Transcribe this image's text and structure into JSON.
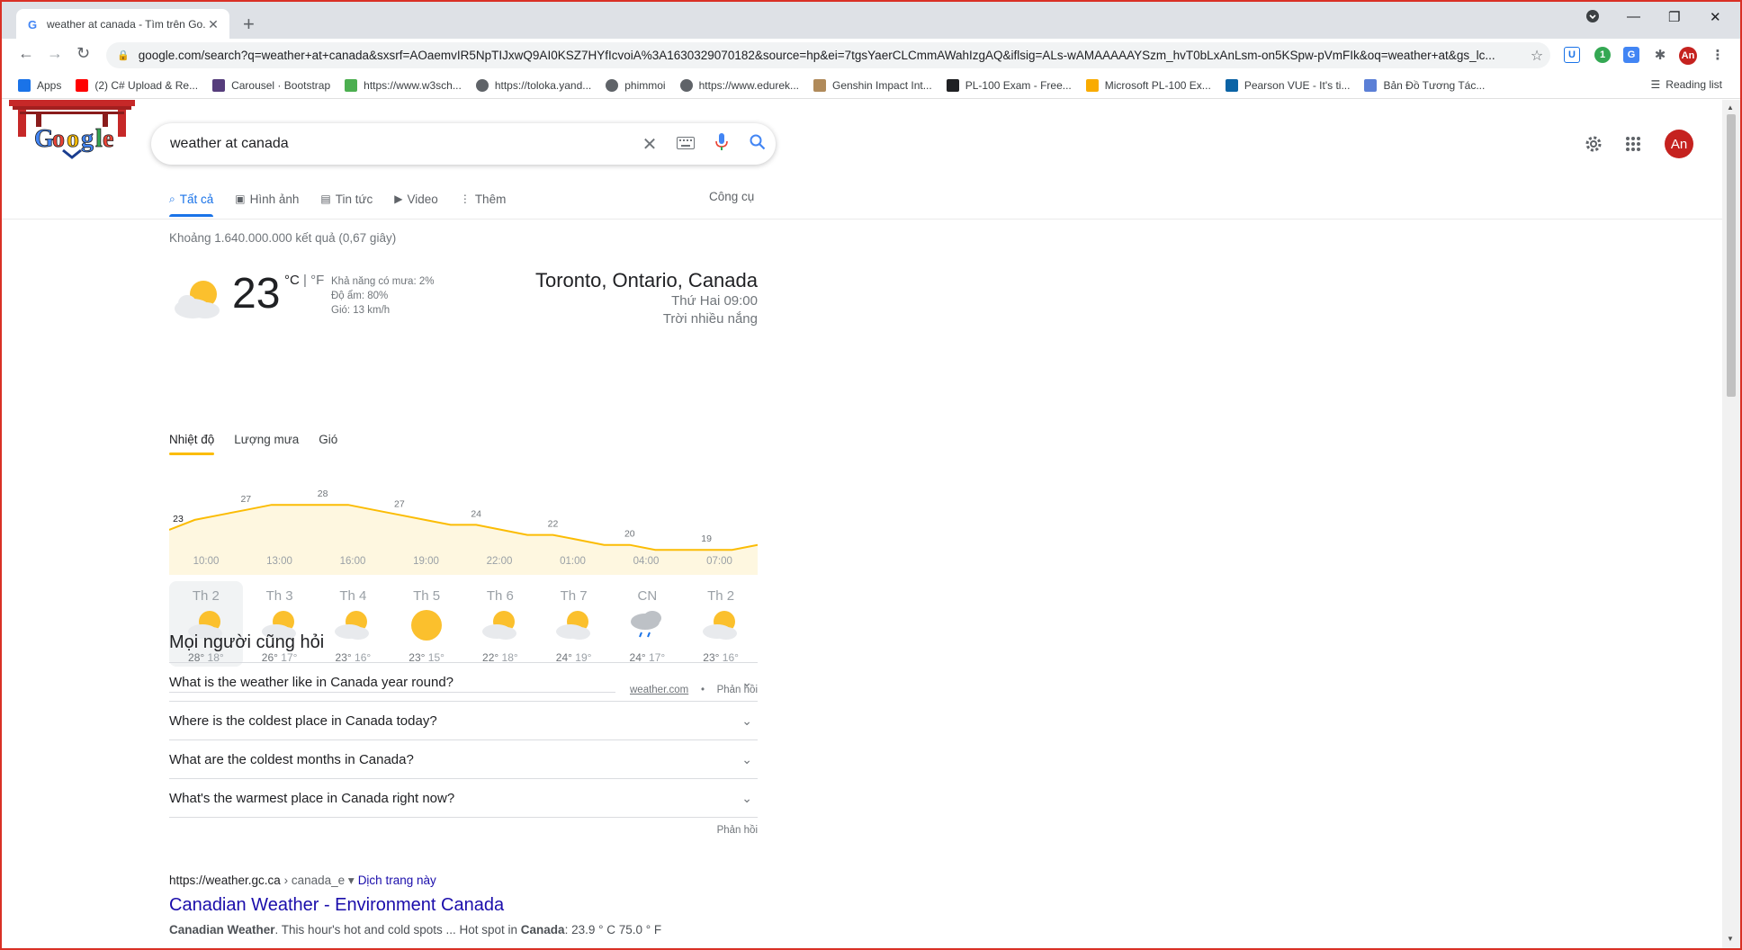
{
  "browser": {
    "tab_title": "weather at canada - Tìm trên Go...",
    "url": "google.com/search?q=weather+at+canada&sxsrf=AOaemvIR5NpTIJxwQ9AI0KSZ7HYfIcvoiA%3A1630329070182&source=hp&ei=7tgsYaerCLCmmAWahIzgAQ&iflsig=ALs-wAMAAAAAYSzm_hvT0bLxAnLsm-on5KSpw-pVmFIk&oq=weather+at&gs_lc...",
    "bookmarks": [
      {
        "label": "Apps",
        "icon": "apps-grid-icon",
        "color": "#1a73e8"
      },
      {
        "label": "(2) C# Upload & Re...",
        "icon": "youtube-icon",
        "color": "#ff0000"
      },
      {
        "label": "Carousel · Bootstrap",
        "icon": "bootstrap-icon",
        "color": "#563d7c"
      },
      {
        "label": "https://www.w3sch...",
        "icon": "w3schools-icon",
        "color": "#4caf50"
      },
      {
        "label": "https://toloka.yand...",
        "icon": "globe-icon",
        "color": "#5f6368"
      },
      {
        "label": "phimmoi",
        "icon": "globe-icon",
        "color": "#5f6368"
      },
      {
        "label": "https://www.edurek...",
        "icon": "globe-icon",
        "color": "#5f6368"
      },
      {
        "label": "Genshin Impact Int...",
        "icon": "genshin-icon",
        "color": "#b08a5a"
      },
      {
        "label": "PL-100 Exam - Free...",
        "icon": "exam-icon",
        "color": "#202124"
      },
      {
        "label": "Microsoft PL-100 Ex...",
        "icon": "crown-icon",
        "color": "#f9ab00"
      },
      {
        "label": "Pearson VUE - It's ti...",
        "icon": "pearson-icon",
        "color": "#0b63a5"
      },
      {
        "label": "Bản Đồ Tương Tác...",
        "icon": "map-icon",
        "color": "#5b7fd6"
      }
    ],
    "reading_list": "Reading list",
    "avatar_initials": "An"
  },
  "search": {
    "query": "weather at canada",
    "tabs": [
      {
        "label": "Tất cả",
        "icon": "search-icon"
      },
      {
        "label": "Hình ảnh",
        "icon": "image-icon"
      },
      {
        "label": "Tin tức",
        "icon": "news-icon"
      },
      {
        "label": "Video",
        "icon": "video-icon"
      },
      {
        "label": "Thêm",
        "icon": "more-vert-icon"
      }
    ],
    "tools_label": "Công cụ",
    "stats": "Khoảng 1.640.000.000 kết quả (0,67 giây)"
  },
  "weather": {
    "temperature": "23",
    "unit_c": "°C",
    "unit_sep": " | ",
    "unit_f": "°F",
    "precip": "Khả năng có mưa: 2%",
    "humidity": "Độ ẩm: 80%",
    "wind": "Gió: 13 km/h",
    "location": "Toronto, Ontario, Canada",
    "time": "Thứ Hai 09:00",
    "condition": "Trời nhiều nắng",
    "tabs": [
      "Nhiệt độ",
      "Lượng mưa",
      "Gió"
    ],
    "source": "weather.com",
    "dot": "•",
    "feedback": "Phản hồi"
  },
  "chart_data": {
    "type": "area",
    "x": [
      "10:00",
      "11:00",
      "12:00",
      "13:00",
      "14:00",
      "15:00",
      "16:00",
      "17:00",
      "18:00",
      "19:00",
      "20:00",
      "21:00",
      "22:00",
      "23:00",
      "00:00",
      "01:00",
      "02:00",
      "03:00",
      "04:00",
      "05:00",
      "06:00",
      "07:00",
      "08:00",
      "09:00"
    ],
    "values": [
      23,
      25,
      26,
      27,
      28,
      28,
      28,
      28,
      27,
      26,
      25,
      24,
      24,
      23,
      22,
      22,
      21,
      20,
      20,
      19,
      19,
      19,
      19,
      20
    ],
    "labels": [
      {
        "index": 0,
        "text": "23"
      },
      {
        "index": 3,
        "text": "27"
      },
      {
        "index": 6,
        "text": "28"
      },
      {
        "index": 9,
        "text": "27"
      },
      {
        "index": 12,
        "text": "24"
      },
      {
        "index": 15,
        "text": "22"
      },
      {
        "index": 18,
        "text": "20"
      },
      {
        "index": 21,
        "text": "19"
      }
    ],
    "tick_labels": [
      "10:00",
      "13:00",
      "16:00",
      "19:00",
      "22:00",
      "01:00",
      "04:00",
      "07:00"
    ],
    "line_color": "#fbbc04",
    "fill_color": "#fef7e0"
  },
  "forecast": [
    {
      "day": "Th 2",
      "hi": "28°",
      "lo": "18°",
      "icon": "partly-cloudy-icon"
    },
    {
      "day": "Th 3",
      "hi": "26°",
      "lo": "17°",
      "icon": "partly-cloudy-icon"
    },
    {
      "day": "Th 4",
      "hi": "23°",
      "lo": "16°",
      "icon": "partly-cloudy-icon"
    },
    {
      "day": "Th 5",
      "hi": "23°",
      "lo": "15°",
      "icon": "sunny-icon"
    },
    {
      "day": "Th 6",
      "hi": "22°",
      "lo": "18°",
      "icon": "partly-cloudy-icon"
    },
    {
      "day": "Th 7",
      "hi": "24°",
      "lo": "19°",
      "icon": "partly-cloudy-icon"
    },
    {
      "day": "CN",
      "hi": "24°",
      "lo": "17°",
      "icon": "rain-icon"
    },
    {
      "day": "Th 2",
      "hi": "23°",
      "lo": "16°",
      "icon": "partly-cloudy-icon"
    }
  ],
  "people_also_ask": {
    "title": "Mọi người cũng hỏi",
    "questions": [
      "What is the weather like in Canada year round?",
      "Where is the coldest place in Canada today?",
      "What are the coldest months in Canada?",
      "What's the warmest place in Canada right now?"
    ],
    "feedback": "Phản hồi"
  },
  "result": {
    "url": "https://weather.gc.ca",
    "path": " › canada_e",
    "translate": "Dịch trang này",
    "title": "Canadian Weather - Environment Canada",
    "snippet_b1": "Canadian Weather",
    "snippet_t1": ". This hour's hot and cold spots ... Hot spot in ",
    "snippet_b2": "Canada",
    "snippet_t2": ": 23.9 ° C 75.0 ° F"
  }
}
